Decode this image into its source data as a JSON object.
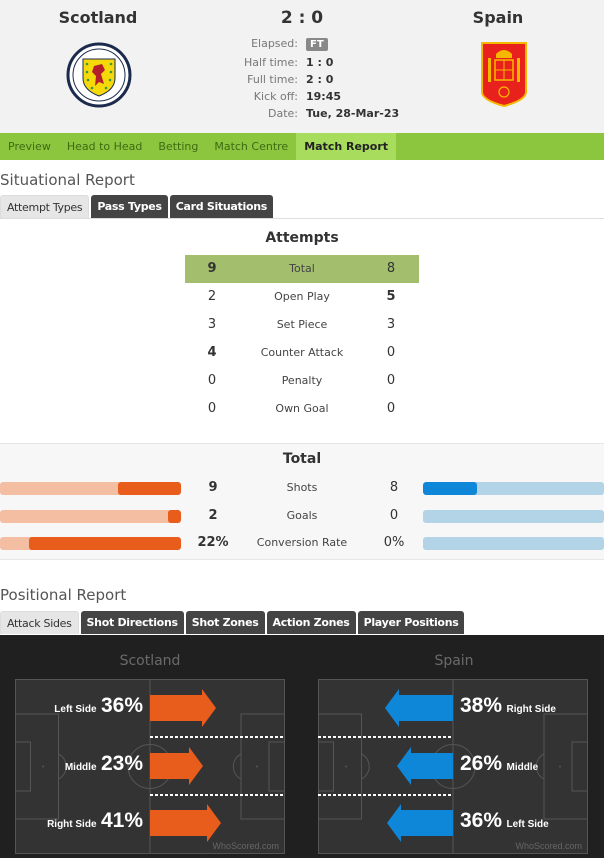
{
  "match": {
    "home_team": "Scotland",
    "away_team": "Spain",
    "score": "2 : 0",
    "info": [
      {
        "label": "Elapsed:",
        "value": "FT"
      },
      {
        "label": "Half time:",
        "value": "1 : 0"
      },
      {
        "label": "Full time:",
        "value": "2 : 0"
      },
      {
        "label": "Kick off:",
        "value": "19:45"
      },
      {
        "label": "Date:",
        "value": "Tue, 28-Mar-23"
      }
    ],
    "home_crest_icon": "scotland-crest-icon",
    "away_crest_icon": "spain-crest-icon"
  },
  "nav": {
    "tabs": [
      {
        "label": "Preview",
        "active": false
      },
      {
        "label": "Head to Head",
        "active": false
      },
      {
        "label": "Betting",
        "active": false
      },
      {
        "label": "Match Centre",
        "active": false
      },
      {
        "label": "Match Report",
        "active": true
      }
    ]
  },
  "situational": {
    "title": "Situational Report",
    "tabs": [
      {
        "label": "Attempt Types",
        "active": true
      },
      {
        "label": "Pass Types",
        "active": false
      },
      {
        "label": "Card Situations",
        "active": false
      }
    ],
    "attempts_title": "Attempts",
    "rows": [
      {
        "label": "Total",
        "home": "9",
        "away": "8",
        "home_bold": true,
        "away_bold": false
      },
      {
        "label": "Open Play",
        "home": "2",
        "away": "5",
        "home_bold": false,
        "away_bold": true
      },
      {
        "label": "Set Piece",
        "home": "3",
        "away": "3",
        "home_bold": false,
        "away_bold": false
      },
      {
        "label": "Counter Attack",
        "home": "4",
        "away": "0",
        "home_bold": true,
        "away_bold": false
      },
      {
        "label": "Penalty",
        "home": "0",
        "away": "0",
        "home_bold": false,
        "away_bold": false
      },
      {
        "label": "Own Goal",
        "home": "0",
        "away": "0",
        "home_bold": false,
        "away_bold": false
      }
    ]
  },
  "totals": {
    "title": "Total",
    "rows": [
      {
        "label": "Shots",
        "home": "9",
        "away": "8",
        "home_fill": 0.35,
        "away_fill": 0.3
      },
      {
        "label": "Goals",
        "home": "2",
        "away": "0",
        "home_fill": 0.07,
        "away_fill": 0.0
      },
      {
        "label": "Conversion Rate",
        "home": "22%",
        "away": "0%",
        "home_fill": 0.84,
        "away_fill": 0.0
      }
    ],
    "colors": {
      "home": "#e85c1c",
      "home_track": "#f4bea3",
      "away": "#0f87d8",
      "away_track": "#b3d4e6"
    }
  },
  "positional": {
    "title": "Positional Report",
    "tabs": [
      {
        "label": "Attack Sides",
        "active": true
      },
      {
        "label": "Shot Directions",
        "active": false
      },
      {
        "label": "Shot Zones",
        "active": false
      },
      {
        "label": "Action Zones",
        "active": false
      },
      {
        "label": "Player Positions",
        "active": false
      }
    ],
    "home": {
      "team": "Scotland",
      "sides": [
        {
          "label": "Left Side",
          "pct": "36%",
          "value": 36
        },
        {
          "label": "Middle",
          "pct": "23%",
          "value": 23
        },
        {
          "label": "Right Side",
          "pct": "41%",
          "value": 41
        }
      ],
      "arrow_color": "#e85c1c"
    },
    "away": {
      "team": "Spain",
      "sides": [
        {
          "label": "Right Side",
          "pct": "38%",
          "value": 38
        },
        {
          "label": "Middle",
          "pct": "26%",
          "value": 26
        },
        {
          "label": "Left Side",
          "pct": "36%",
          "value": 36
        }
      ],
      "arrow_color": "#0f87d8"
    },
    "watermark": "WhoScored.com"
  }
}
